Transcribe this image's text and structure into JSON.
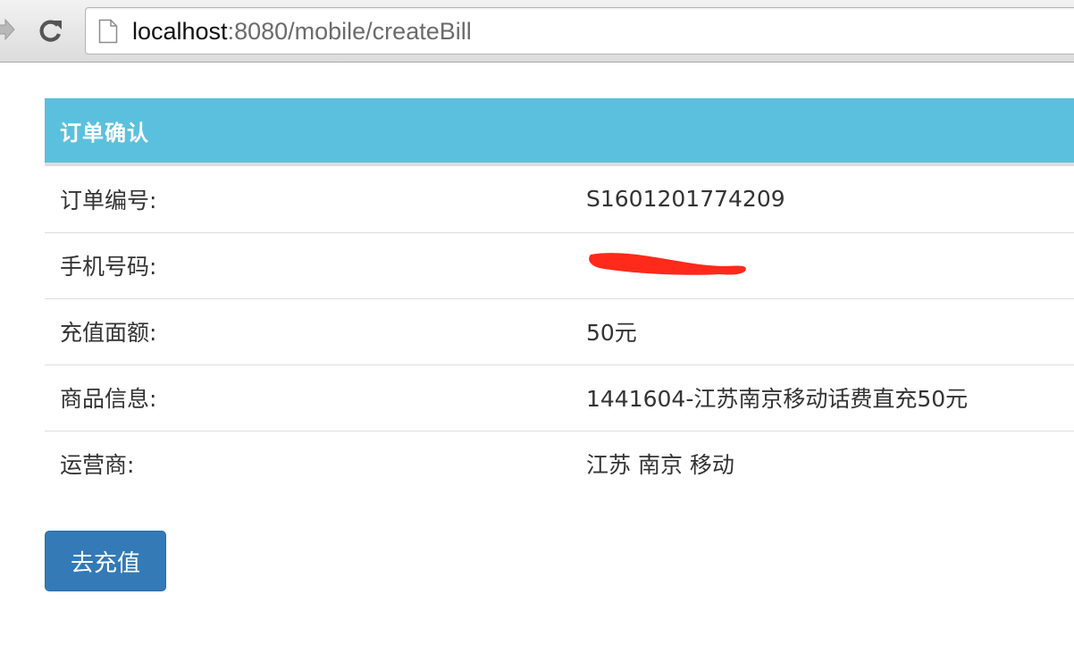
{
  "browser": {
    "url_host": "localhost",
    "url_rest": ":8080/mobile/createBill",
    "icons": {
      "forward": "forward-arrow-icon",
      "reload": "reload-icon",
      "page": "page-icon"
    }
  },
  "panel": {
    "title": "订单确认",
    "heading_color": "#5bc0de",
    "rows": [
      {
        "label": "订单编号:",
        "value": "S1601201774209"
      },
      {
        "label": "手机号码:",
        "value": ""
      },
      {
        "label": "充值面额:",
        "value": "50元"
      },
      {
        "label": "商品信息:",
        "value": "1441604-江苏南京移动话费直充50元"
      },
      {
        "label": "运营商:",
        "value": "江苏 南京 移动"
      }
    ]
  },
  "actions": {
    "submit_label": "去充值",
    "button_color": "#337ab7"
  },
  "redaction_color": "#ff2a1a"
}
